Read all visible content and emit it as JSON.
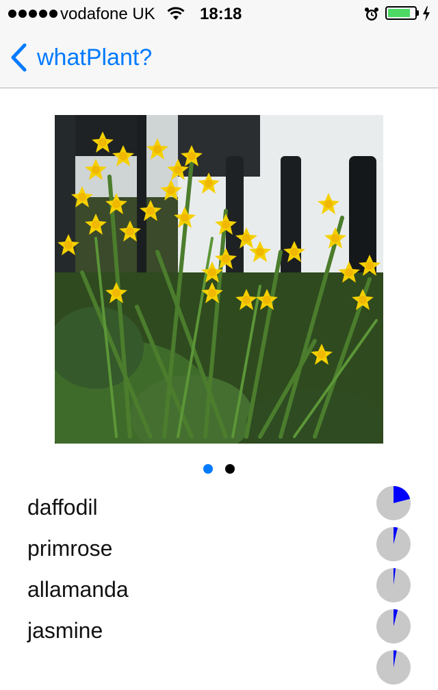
{
  "status_bar": {
    "carrier": "vodafone UK",
    "time": "18:18",
    "battery_fraction": 0.85,
    "signal_dots": 5,
    "icons": [
      "wifi-icon",
      "alarm-icon",
      "battery-icon",
      "charging-bolt-icon"
    ]
  },
  "nav": {
    "back_label": "whatPlant?",
    "back_icon": "chevron-left-icon"
  },
  "photo": {
    "subject": "daffodil-photo"
  },
  "pager": {
    "page_count": 2,
    "current_page": 1,
    "active_color": "#007aff",
    "inactive_color": "#000000"
  },
  "results": [
    {
      "name": "daffodil",
      "confidence": 0.21
    },
    {
      "name": "primrose",
      "confidence": 0.04
    },
    {
      "name": "allamanda",
      "confidence": 0.02
    },
    {
      "name": "jasmine",
      "confidence": 0.04
    },
    {
      "name": "",
      "confidence": 0.03
    }
  ],
  "colors": {
    "accent": "#007aff",
    "pie_fill": "#0000ff",
    "pie_track": "#c8c8c8",
    "battery": "#4cd964"
  }
}
